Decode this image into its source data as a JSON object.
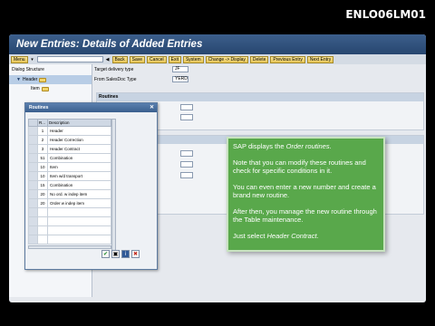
{
  "course_code": "ENLO06LM01",
  "window": {
    "title": "New Entries: Details of Added Entries"
  },
  "toolbar": {
    "menu": "Menu",
    "back": "Back",
    "save": "Save",
    "cancel": "Cancel",
    "exit": "Exit",
    "system": "System",
    "change_display": "Change -> Display",
    "delete": "Delete",
    "previous_entry": "Previous Entry",
    "next_entry": "Next Entry"
  },
  "tree": {
    "title": "Dialog Structure",
    "items": [
      {
        "label": "Header"
      },
      {
        "label": "Item"
      }
    ]
  },
  "fields": {
    "target_label": "Target delivery type",
    "target_value": "JF",
    "from_label": "From SalesDoc Type",
    "from_value": "YERD"
  },
  "sections": {
    "routines_head": "Routines"
  },
  "popup": {
    "title": "Routines",
    "columns": [
      "R...",
      "Description"
    ],
    "rows": [
      {
        "num": "1",
        "desc": "Header"
      },
      {
        "num": "2",
        "desc": "Header Correction"
      },
      {
        "num": "3",
        "desc": "Header Contract"
      },
      {
        "num": "51",
        "desc": "Combination"
      },
      {
        "num": "10",
        "desc": "Item"
      },
      {
        "num": "10",
        "desc": "Item w/d transport"
      },
      {
        "num": "15",
        "desc": "Combination"
      },
      {
        "num": "20",
        "desc": "No ord. w indep item"
      },
      {
        "num": "20",
        "desc": "Order w indep item"
      }
    ],
    "buttons": {
      "ok": "✔",
      "copy": "▣",
      "info": "i",
      "cancel": "✖"
    }
  },
  "callout": {
    "p1_pre": "SAP displays the ",
    "p1_em": "Order routines",
    "p1_post": ".",
    "p2": "Note that you can modify these routines and check for specific conditions in it.",
    "p3": "You can even enter a new number and create a brand new routine.",
    "p4": "After then, you manage the new routine through the Table maintenance.",
    "p5_pre": "Just select ",
    "p5_em": "Header Contract",
    "p5_post": "."
  }
}
